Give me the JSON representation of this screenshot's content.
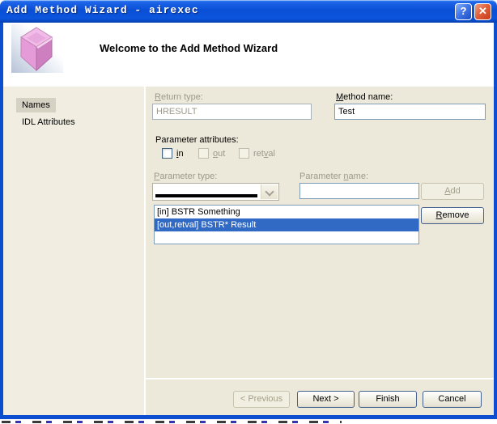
{
  "window": {
    "title": "Add Method Wizard - airexec",
    "help_glyph": "?",
    "close_glyph": "✕"
  },
  "header": {
    "title": "Welcome to the Add Method Wizard"
  },
  "sidebar": {
    "items": [
      "Names",
      "IDL Attributes"
    ],
    "selected": "Names"
  },
  "form": {
    "return_type": {
      "pre": "",
      "accel": "R",
      "post": "eturn type:",
      "value": "HRESULT"
    },
    "method_name": {
      "pre": "",
      "accel": "M",
      "post": "ethod name:",
      "value": "Test"
    },
    "parameter_attributes": "Parameter attributes:",
    "attr_in": {
      "pre": "",
      "accel": "i",
      "post": "n"
    },
    "attr_out": {
      "pre": "",
      "accel": "o",
      "post": "ut"
    },
    "attr_retval": {
      "pre": "ret",
      "accel": "v",
      "post": "al"
    },
    "parameter_type": {
      "pre": "",
      "accel": "P",
      "post": "arameter type:",
      "value": ""
    },
    "parameter_name": {
      "pre": "Parameter ",
      "accel": "n",
      "post": "ame:",
      "value": ""
    },
    "add": {
      "pre": "",
      "accel": "A",
      "post": "dd"
    },
    "remove": {
      "pre": "",
      "accel": "R",
      "post": "emove"
    },
    "parameters_list": {
      "items": [
        "[in] BSTR Something",
        "[out,retval] BSTR* Result"
      ],
      "selected_index": 1
    }
  },
  "footer": {
    "previous": "< Previous",
    "next": "Next >",
    "finish": "Finish",
    "cancel": "Cancel"
  },
  "colors": {
    "selection_blue": "#316AC5",
    "titlebar_blue": "#0B4FD0",
    "sidebar_bg": "#F1EEE1",
    "panel_bg": "#EDE9DA"
  }
}
